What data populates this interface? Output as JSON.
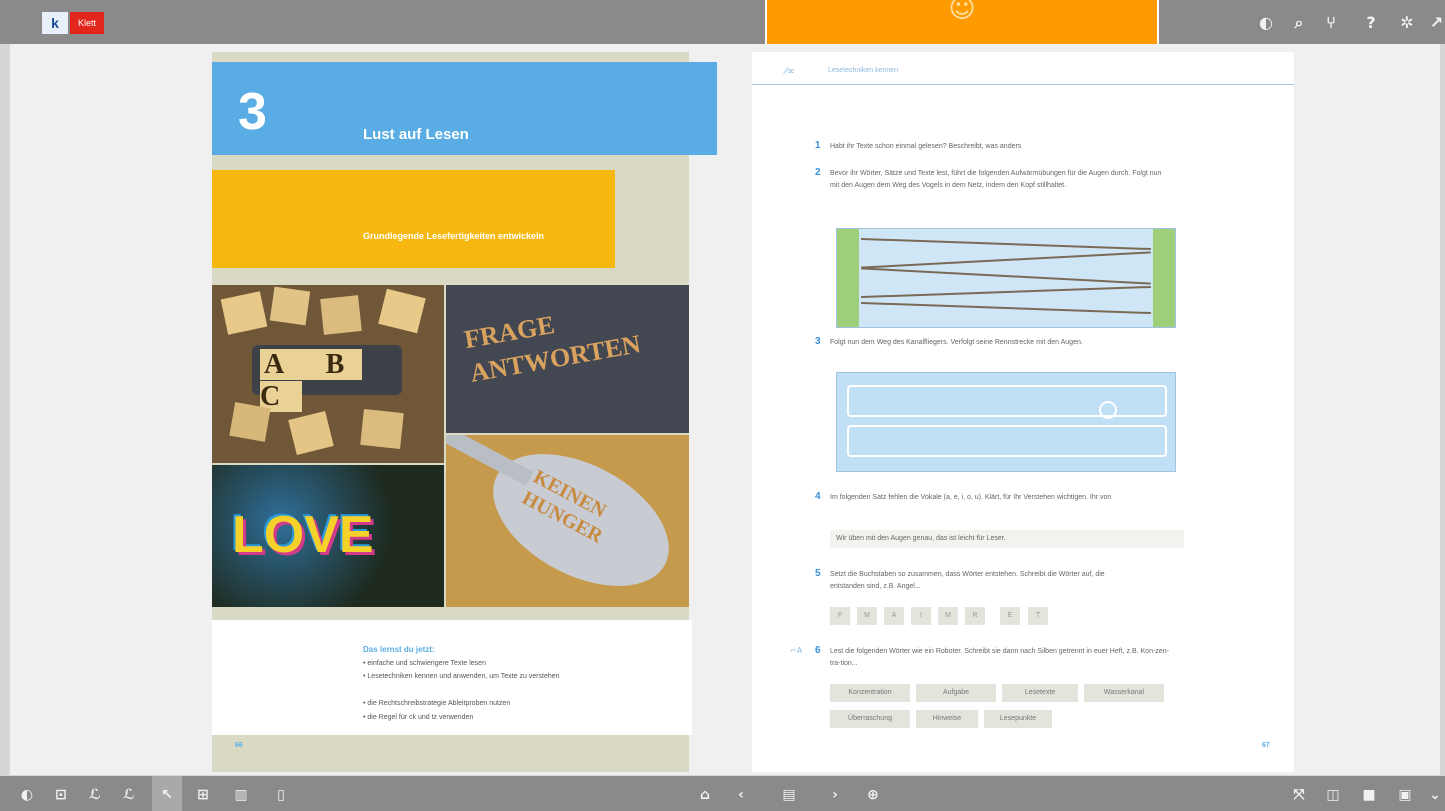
{
  "toolbar_top": {
    "logo_k": "k",
    "logo_brand": "Klett",
    "popup_emoji": "☺",
    "icons": [
      "palette-icon",
      "search-icon",
      "toc-icon",
      "help-icon",
      "settings-icon",
      "expand-icon"
    ]
  },
  "left_page": {
    "chapter_number": "3",
    "chapter_title": "Lust auf Lesen",
    "subtitle": "Grundlegende Lesefertigkeiten entwickeln",
    "images": {
      "abc": "A B C",
      "frage": "FRAGE ANTWORTEN",
      "love": "LOVE",
      "spoon": "KEINEN HUNGER"
    },
    "learn_title": "Das lernst du jetzt:",
    "learn_items": [
      "einfache und schwierigere Texte lesen",
      "Lesetechniken kennen und anwenden, um Texte zu verstehen",
      "die Rechtschreibstrategie Ableitproben nutzen",
      "die Regel für ck und tz verwenden"
    ],
    "page_number": "66"
  },
  "right_page": {
    "header": "Lesetechniken kennen",
    "tasks": [
      {
        "num": "1",
        "text": "Habt ihr Texte schon einmal gelesen? Beschreibt, was anders"
      },
      {
        "num": "2",
        "text": "Bevor ihr Wörter, Sätze und Texte lest, führt die folgenden Aufwärmübungen für die Augen durch. Folgt nun mit den Augen dem Weg des Vogels in dem Netz, indem den Kopf stillhaltet."
      },
      {
        "num": "3",
        "text": "Folgt nun dem Weg des Kanalfliegers. Verfolgt seine Rennstrecke mit den Augen."
      },
      {
        "num": "4",
        "text": "Im folgenden Satz fehlen die Vokale (a, e, i, o, u). Klärt, für Ihr Verstehen wichtigen. Ihr von"
      },
      {
        "num": "5",
        "text": "Setzt die Buchstaben so zusammen, dass Wörter entstehen. Schreibt die Wörter auf, die entstanden sind, z.B. Angel..."
      },
      {
        "num": "6",
        "text": "Lest die folgenden Wörter wie ein Roboter. Schreibt sie dann nach Silben getrennt in euer Heft, z.B. Kon-zen-tra-tion..."
      }
    ],
    "example_sentence": "Wir üben mit den Augen genau, das ist leicht für Leser.",
    "letters": [
      "F",
      "M",
      "A",
      "I",
      "M",
      "R",
      "E",
      "T"
    ],
    "words": [
      "Konzentration",
      "Aufgabe",
      "Lesetexte",
      "Wasserkanal",
      "Überraschung",
      "Hinweise",
      "Lesepunkte"
    ],
    "page_number": "67"
  },
  "toolbar_bottom": {
    "icons": [
      "toggle-icon",
      "bookmark-icon",
      "pen-icon",
      "highlighter-icon",
      "pointer-icon",
      "tools-icon",
      "trash-icon",
      "page-icon",
      "home-icon",
      "prev-icon",
      "pages-icon",
      "next-icon",
      "zoom-icon",
      "fullscreen-icon",
      "double-page-icon",
      "single-page-icon",
      "window-icon",
      "collapse-icon"
    ]
  }
}
